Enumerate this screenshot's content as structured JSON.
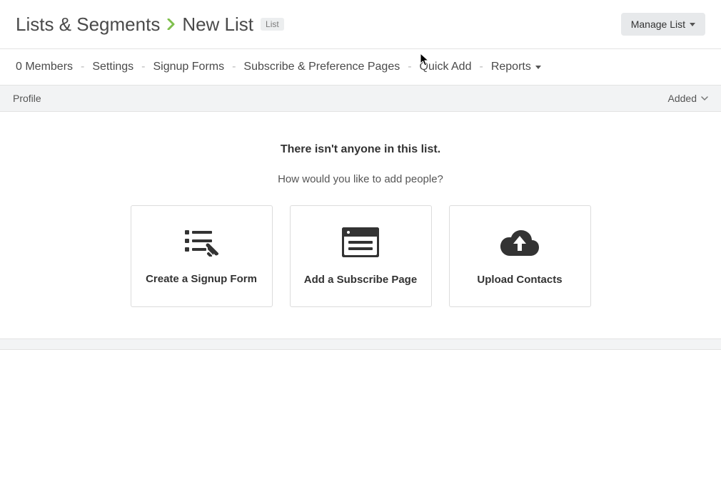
{
  "breadcrumb": {
    "root": "Lists & Segments",
    "current": "New List",
    "badge": "List"
  },
  "actions": {
    "manage_label": "Manage List"
  },
  "tabs": {
    "members": "0 Members",
    "settings": "Settings",
    "signup_forms": "Signup Forms",
    "subscribe_pages": "Subscribe & Preference Pages",
    "quick_add": "Quick Add",
    "reports": "Reports"
  },
  "listbar": {
    "left": "Profile",
    "right": "Added"
  },
  "empty_state": {
    "heading": "There isn't anyone in this list.",
    "subheading": "How would you like to add people?",
    "cards": {
      "signup": "Create a Signup Form",
      "subscribe": "Add a Subscribe Page",
      "upload": "Upload Contacts"
    }
  }
}
